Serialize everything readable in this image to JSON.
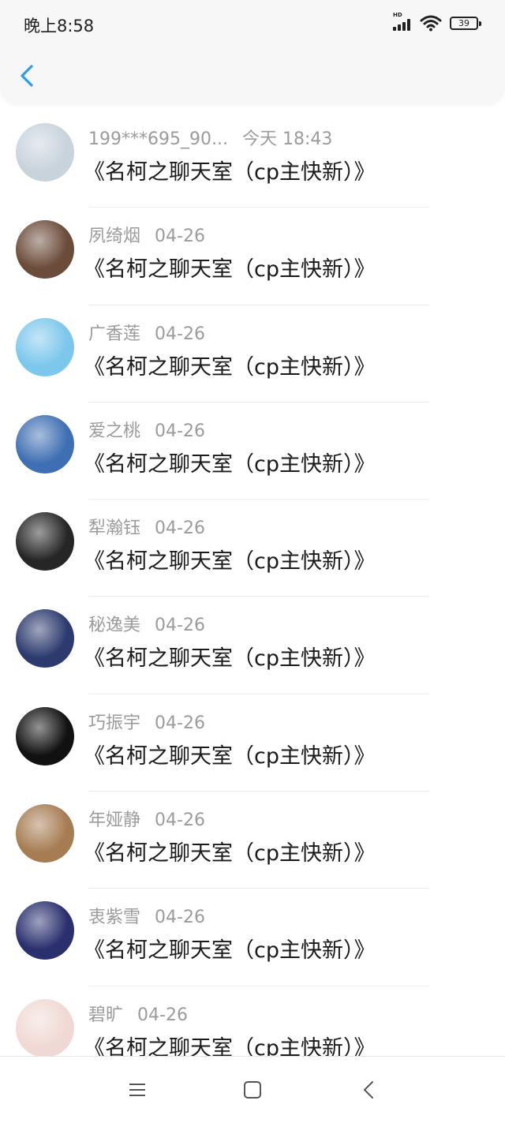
{
  "status_bar": {
    "time": "晚上8:58",
    "network": "HD",
    "battery": "39",
    "icons": [
      "signal-icon",
      "wifi-icon",
      "battery-icon"
    ]
  },
  "header": {
    "back_icon": "chevron-left-icon",
    "accent_color": "#2f9cf3"
  },
  "items": [
    {
      "name": "199***695_90...",
      "time": "今天 18:43",
      "title": "《名柯之聊天室（cp主快新）》",
      "avatar_color": "#c8d3dc"
    },
    {
      "name": "夙绮烟",
      "time": "04-26",
      "title": "《名柯之聊天室（cp主快新）》",
      "avatar_color": "#6b4b3a"
    },
    {
      "name": "广香莲",
      "time": "04-26",
      "title": "《名柯之聊天室（cp主快新）》",
      "avatar_color": "#7cc7ec"
    },
    {
      "name": "爱之桃",
      "time": "04-26",
      "title": "《名柯之聊天室（cp主快新）》",
      "avatar_color": "#3f6fb3"
    },
    {
      "name": "犁瀚钰",
      "time": "04-26",
      "title": "《名柯之聊天室（cp主快新）》",
      "avatar_color": "#262626"
    },
    {
      "name": "秘逸美",
      "time": "04-26",
      "title": "《名柯之聊天室（cp主快新）》",
      "avatar_color": "#2c3a6e"
    },
    {
      "name": "巧振宇",
      "time": "04-26",
      "title": "《名柯之聊天室（cp主快新）》",
      "avatar_color": "#111111"
    },
    {
      "name": "年娅静",
      "time": "04-26",
      "title": "《名柯之聊天室（cp主快新）》",
      "avatar_color": "#a67c52"
    },
    {
      "name": "衷紫雪",
      "time": "04-26",
      "title": "《名柯之聊天室（cp主快新）》",
      "avatar_color": "#2a2f6e"
    },
    {
      "name": "碧旷",
      "time": "04-26",
      "title": "《名柯之聊天室（cp主快新）》",
      "avatar_color": "#f0d9d4"
    }
  ],
  "bottom_nav": {
    "icons": [
      "menu-icon",
      "home-square-icon",
      "back-triangle-icon"
    ]
  }
}
